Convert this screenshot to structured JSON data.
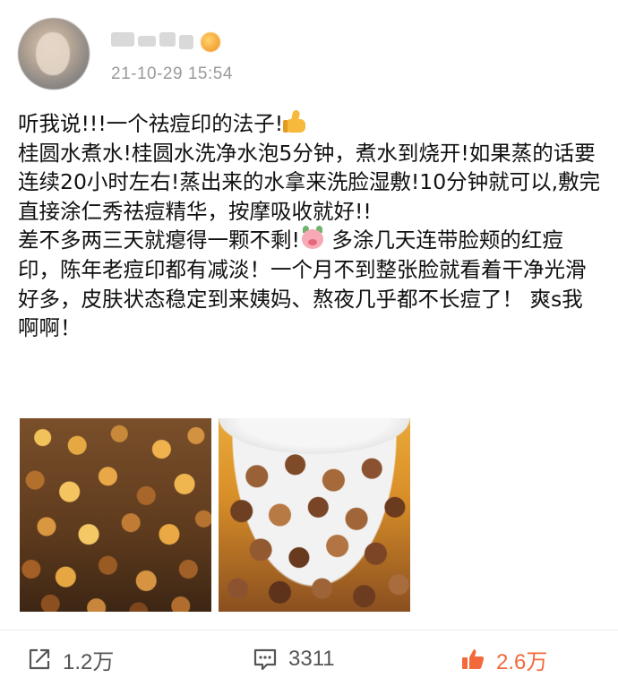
{
  "post": {
    "author": {
      "name": "",
      "timestamp": "21-10-29 15:54"
    },
    "paragraphs": [
      {
        "text": "听我说!!!一个祛痘印的法子!",
        "emoji": "thumbs-up"
      },
      {
        "text": "桂圆水煮水!桂圆水洗净水泡5分钟，煮水到烧开!如果蒸的话要连续20小时左右!蒸出来的水拿来洗脸湿敷!10分钟就可以,敷完直接涂仁秀祛痘精华，按摩吸收就好!!"
      },
      {
        "text_before": "差不多两三天就瘪得一颗不剩!",
        "emoji": "pig-face",
        "text_after": " 多涂几天连带脸颊的红痘印，陈年老痘印都有减淡！一个月不到整张脸就看着干净光滑好多，皮肤状态稳定到来姨妈、熬夜几乎都不长痘了！ 爽s我啊啊！"
      }
    ],
    "images": [
      {
        "label": "boiling-longan-shells-photo"
      },
      {
        "label": "longan-shells-in-bowl-photo"
      }
    ]
  },
  "actions": {
    "share_count": "1.2万",
    "comment_count": "3311",
    "like_count": "2.6万"
  },
  "icons": {
    "share": "share-icon",
    "comment": "comment-icon",
    "like": "thumbs-up-icon"
  },
  "colors": {
    "like_accent": "#f26a3b",
    "timestamp": "#9a9a9a",
    "action_text": "#555555"
  }
}
